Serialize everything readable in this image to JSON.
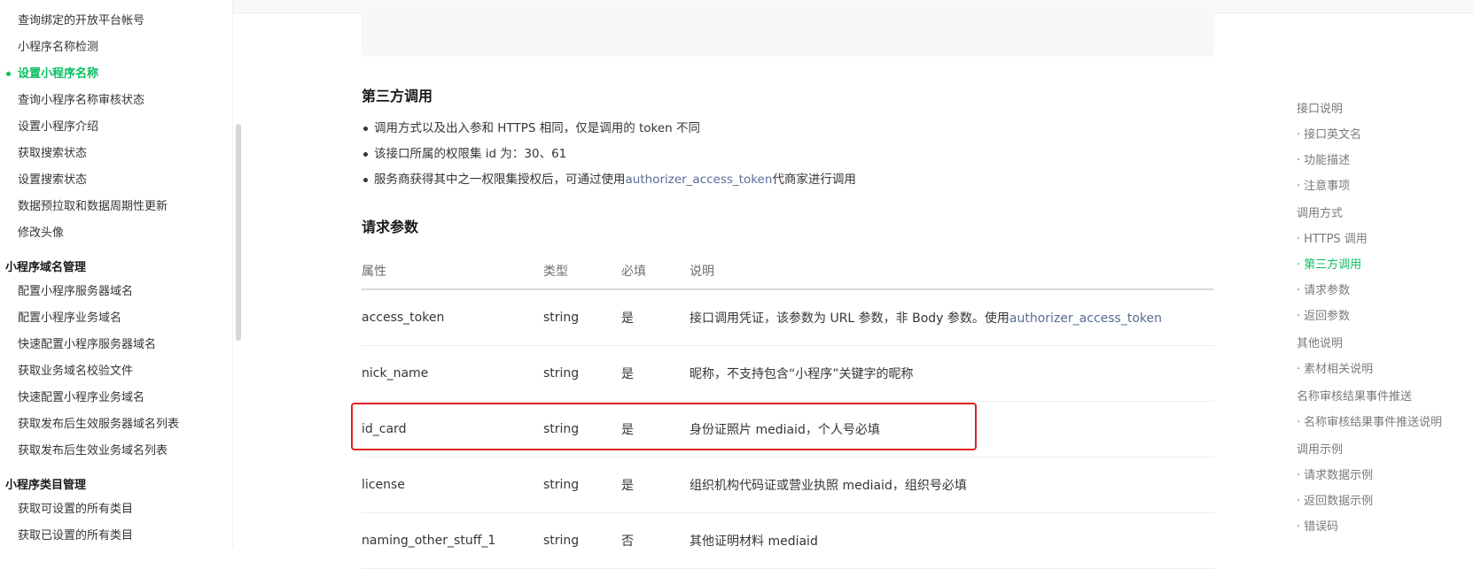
{
  "sidebar": {
    "items": [
      {
        "label": "查询绑定的开放平台帐号",
        "type": "item"
      },
      {
        "label": "小程序名称检测",
        "type": "item"
      },
      {
        "label": "设置小程序名称",
        "type": "active"
      },
      {
        "label": "查询小程序名称审核状态",
        "type": "item"
      },
      {
        "label": "设置小程序介绍",
        "type": "item"
      },
      {
        "label": "获取搜索状态",
        "type": "item"
      },
      {
        "label": "设置搜索状态",
        "type": "item"
      },
      {
        "label": "数据预拉取和数据周期性更新",
        "type": "item"
      },
      {
        "label": "修改头像",
        "type": "item"
      },
      {
        "label": "小程序域名管理",
        "type": "group"
      },
      {
        "label": "配置小程序服务器域名",
        "type": "item"
      },
      {
        "label": "配置小程序业务域名",
        "type": "item"
      },
      {
        "label": "快速配置小程序服务器域名",
        "type": "item"
      },
      {
        "label": "获取业务域名校验文件",
        "type": "item"
      },
      {
        "label": "快速配置小程序业务域名",
        "type": "item"
      },
      {
        "label": "获取发布后生效服务器域名列表",
        "type": "item"
      },
      {
        "label": "获取发布后生效业务域名列表",
        "type": "item"
      },
      {
        "label": "小程序类目管理",
        "type": "group"
      },
      {
        "label": "获取可设置的所有类目",
        "type": "item"
      },
      {
        "label": "获取已设置的所有类目",
        "type": "item"
      }
    ]
  },
  "main": {
    "third_party": {
      "title": "第三方调用",
      "bullet1": "调用方式以及出入参和 HTTPS 相同，仅是调用的 token 不同",
      "bullet2": "该接口所属的权限集 id 为：30、61",
      "bullet3_pre": "服务商获得其中之一权限集授权后，可通过使用",
      "bullet3_link": "authorizer_access_token",
      "bullet3_post": "代商家进行调用"
    },
    "params": {
      "title": "请求参数",
      "headers": [
        "属性",
        "类型",
        "必填",
        "说明"
      ],
      "rows": [
        {
          "name": "access_token",
          "type": "string",
          "required": "是",
          "desc": "接口调用凭证，该参数为 URL 参数，非 Body 参数。使用",
          "desc_link": "authorizer_access_token"
        },
        {
          "name": "nick_name",
          "type": "string",
          "required": "是",
          "desc": "昵称，不支持包含“小程序”关键字的昵称",
          "desc_link": ""
        },
        {
          "name": "id_card",
          "type": "string",
          "required": "是",
          "desc": "身份证照片 mediaid，个人号必填",
          "desc_link": ""
        },
        {
          "name": "license",
          "type": "string",
          "required": "是",
          "desc": "组织机构代码证或营业执照 mediaid，组织号必填",
          "desc_link": ""
        },
        {
          "name": "naming_other_stuff_1",
          "type": "string",
          "required": "否",
          "desc": "其他证明材料 mediaid",
          "desc_link": ""
        }
      ]
    }
  },
  "toc": {
    "items": [
      {
        "label": "接口说明",
        "level": 1
      },
      {
        "label": "接口英文名",
        "level": 2
      },
      {
        "label": "功能描述",
        "level": 2
      },
      {
        "label": "注意事项",
        "level": 2
      },
      {
        "label": "调用方式",
        "level": 1
      },
      {
        "label": "HTTPS 调用",
        "level": 2
      },
      {
        "label": "第三方调用",
        "level": 2,
        "active": true
      },
      {
        "label": "请求参数",
        "level": 2
      },
      {
        "label": "返回参数",
        "level": 2
      },
      {
        "label": "其他说明",
        "level": 1
      },
      {
        "label": "素材相关说明",
        "level": 2
      },
      {
        "label": "名称审核结果事件推送",
        "level": 1
      },
      {
        "label": "名称审核结果事件推送说明",
        "level": 2
      },
      {
        "label": "调用示例",
        "level": 1
      },
      {
        "label": "请求数据示例",
        "level": 2
      },
      {
        "label": "返回数据示例",
        "level": 2
      },
      {
        "label": "错误码",
        "level": 2
      }
    ]
  },
  "colors": {
    "accent": "#07c160",
    "link": "#576b95",
    "highlight": "#e02020"
  }
}
